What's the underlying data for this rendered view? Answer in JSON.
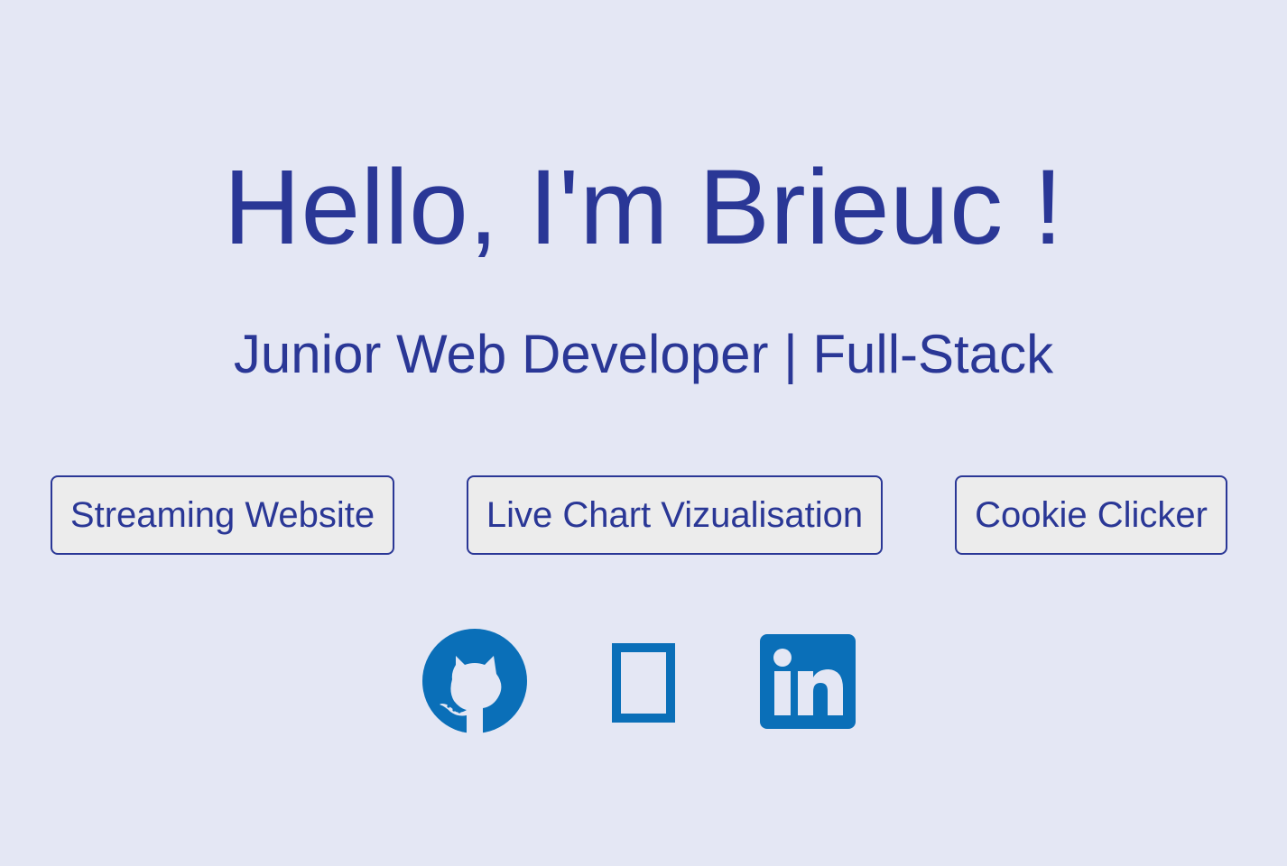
{
  "hero": {
    "title": "Hello, I'm Brieuc !",
    "subtitle": "Junior Web Developer | Full-Stack"
  },
  "projects": [
    {
      "label": "Streaming Website"
    },
    {
      "label": "Live Chart Vizualisation"
    },
    {
      "label": "Cookie Clicker"
    }
  ],
  "social": [
    {
      "icon": "github-icon"
    },
    {
      "icon": "missing-glyph-icon"
    },
    {
      "icon": "linkedin-icon"
    }
  ],
  "colors": {
    "background": "#e4e7f4",
    "text": "#2a3796",
    "button_bg": "#ececec",
    "icon_blue": "#0a6fb8"
  }
}
